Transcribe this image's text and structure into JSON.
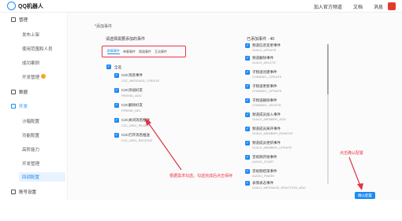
{
  "app": {
    "title": "QQ机器人"
  },
  "top_nav": {
    "join_channel": "加入官方频道",
    "docs": "文档",
    "menu": "消息"
  },
  "sidebar": {
    "groups": [
      {
        "label": "管理"
      },
      {
        "label": "数据"
      },
      {
        "label": "开发"
      },
      {
        "label": "账号设置"
      }
    ],
    "sub_items": [
      "发布上架",
      "使用范围和人员",
      "成功案例",
      "开发管理",
      "沙箱配置",
      "功能配置",
      "高阶能力",
      "开发管理",
      "回调配置"
    ]
  },
  "page": {
    "title": "*添加事件",
    "left_title": "请选择需要添加的事件",
    "right_title": "已添加事件 · 40",
    "tabs": [
      "群聊事件",
      "单聊事件",
      "频道事件",
      "互动事件"
    ],
    "select_all": "全选",
    "events_left": [
      {
        "name": "C2C消息事件",
        "code": "C2C_MESSAGE_CREATE"
      },
      {
        "name": "C2C添加好友",
        "code": "FRIEND_ADD"
      },
      {
        "name": "C2C删除好友",
        "code": "FRIEND_DEL"
      },
      {
        "name": "C2C关闭消息推送",
        "code": "C2C_MSG_REJECT"
      },
      {
        "name": "C2C打开消息推送",
        "code": "C2C_MSG_RECEIVE"
      }
    ],
    "events_right": [
      {
        "name": "频道信息变更事件",
        "code": "GUILD_UPDATE"
      },
      {
        "name": "频道删除事件",
        "code": "GUILD_DELETE"
      },
      {
        "name": "子频道创建事件",
        "code": "CHANNEL_CREATE"
      },
      {
        "name": "子频道更新事件",
        "code": "CHANNEL_UPDATE"
      },
      {
        "name": "子频道删除事件",
        "code": "CHANNEL_DELETE"
      },
      {
        "name": "频道成员加入事件",
        "code": "GUILD_MEMBER_ADD"
      },
      {
        "name": "频道成员离开事件",
        "code": "GUILD_MEMBER_REMOVE"
      },
      {
        "name": "频道成员更新事件",
        "code": "GUILD_MEMBER_UPDATE"
      },
      {
        "name": "音视频开始事件",
        "code": "AUDIO_START"
      },
      {
        "name": "音视频结束事件",
        "code": "AUDIO_FINISH"
      },
      {
        "name": "表情表态事件",
        "code": "GUILD_MESSAGE_REACTION_ADD"
      }
    ],
    "annotation_left": "根据需求勾选，勾选完成后点击保存",
    "annotation_right": "点击确认配置",
    "save_button": "确认配置"
  },
  "colors": {
    "accent": "#1d8bf1",
    "annotation": "#e33344"
  }
}
